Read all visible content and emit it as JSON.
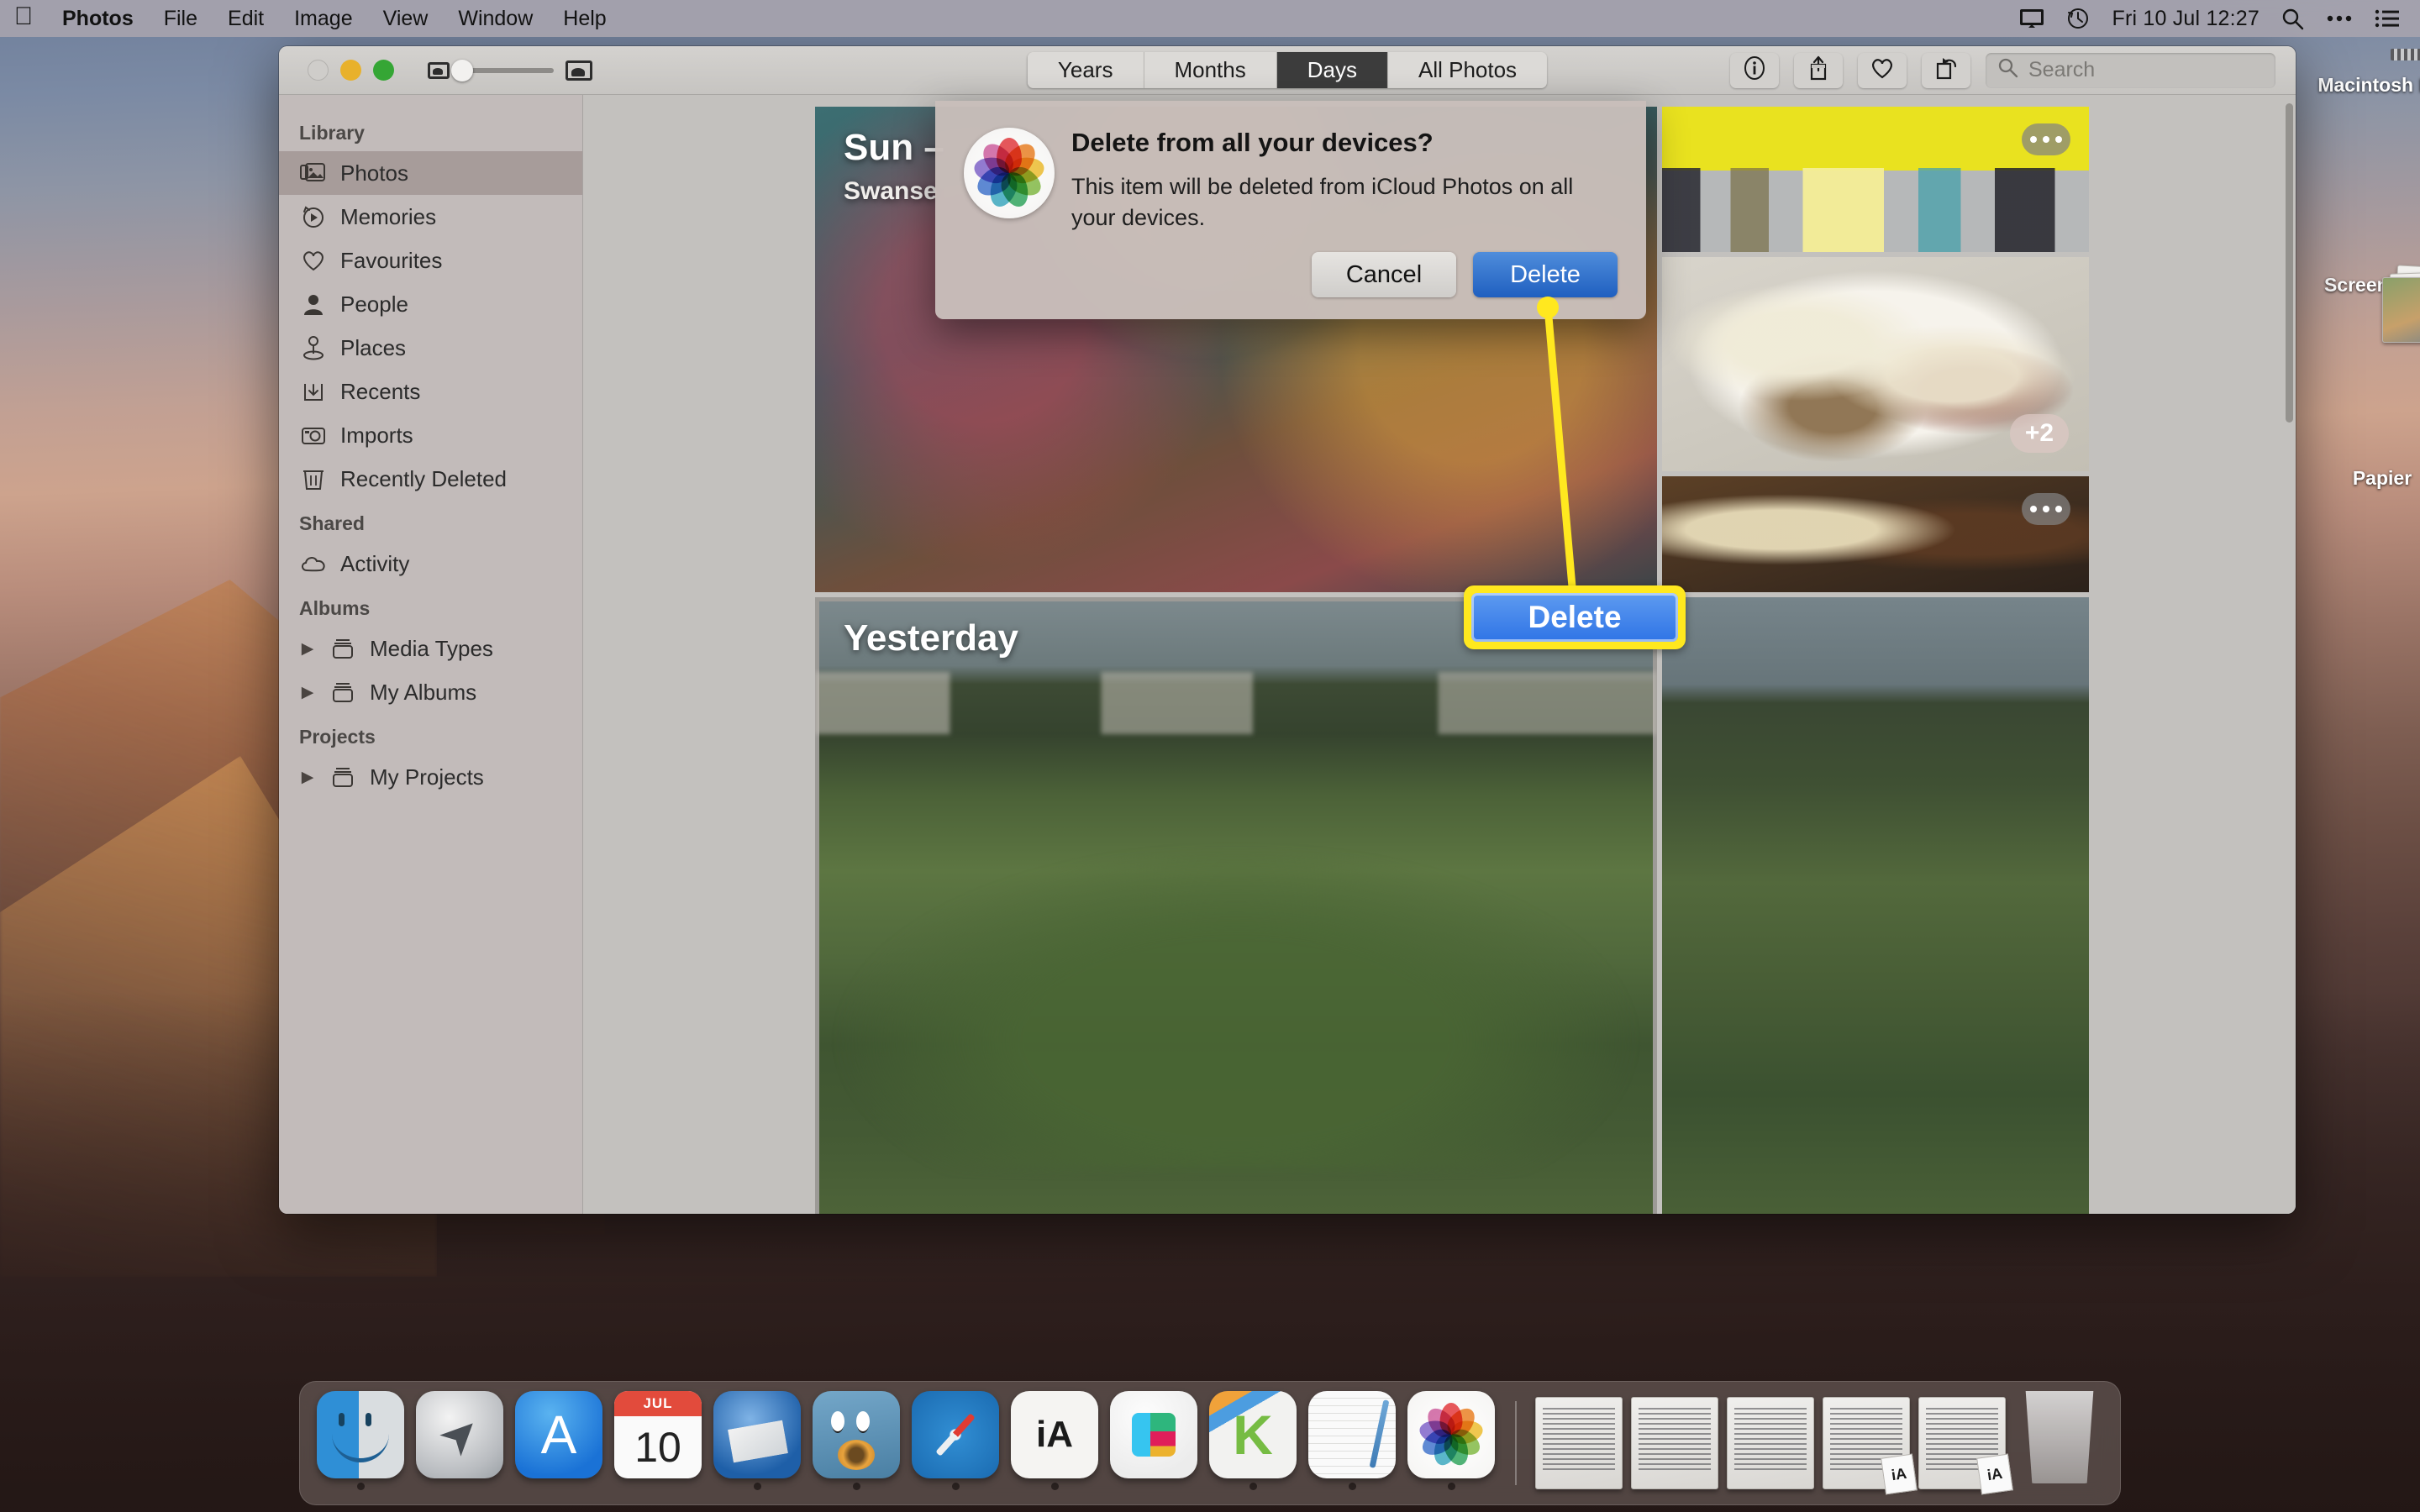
{
  "menubar": {
    "apple_logo": "apple-logo",
    "items": [
      "Photos",
      "File",
      "Edit",
      "Image",
      "View",
      "Window",
      "Help"
    ],
    "status": {
      "display_icon": "display-icon",
      "timemachine_icon": "time-machine-icon",
      "clock": "Fri 10 Jul  12:27",
      "search_icon": "search-icon",
      "control_center_icon": "control-center-icon",
      "siri_list_icon": "list-icon"
    }
  },
  "desktop": {
    "icons": [
      {
        "label": "Macintosh HD",
        "icon": "hard-drive-icon"
      },
      {
        "label": "Screenshots",
        "icon": "screenshots-folder-icon"
      },
      {
        "label": "Papier",
        "icon": "papier-folder-icon"
      }
    ]
  },
  "window": {
    "traffic_lights": [
      "close",
      "minimize",
      "maximize"
    ],
    "zoom_slider": {
      "small_icon": "small-thumbnail-icon",
      "large_icon": "large-thumbnail-icon",
      "value": 10
    },
    "segmented": {
      "options": [
        "Years",
        "Months",
        "Days",
        "All Photos"
      ],
      "selected": "Days"
    },
    "toolbar_buttons": [
      {
        "name": "info-button",
        "icon": "info-icon"
      },
      {
        "name": "share-button",
        "icon": "share-icon"
      },
      {
        "name": "favourite-button",
        "icon": "heart-icon"
      },
      {
        "name": "rotate-button",
        "icon": "rotate-icon"
      }
    ],
    "search": {
      "placeholder": "Search",
      "value": "",
      "icon": "search-icon"
    }
  },
  "sidebar": {
    "sections": [
      {
        "header": "Library",
        "items": [
          {
            "label": "Photos",
            "icon": "photos-stack-icon",
            "selected": true
          },
          {
            "label": "Memories",
            "icon": "memories-icon",
            "selected": false
          },
          {
            "label": "Favourites",
            "icon": "heart-icon",
            "selected": false
          },
          {
            "label": "People",
            "icon": "person-icon",
            "selected": false
          },
          {
            "label": "Places",
            "icon": "map-pin-icon",
            "selected": false
          },
          {
            "label": "Recents",
            "icon": "download-tray-icon",
            "selected": false
          },
          {
            "label": "Imports",
            "icon": "camera-icon",
            "selected": false
          },
          {
            "label": "Recently Deleted",
            "icon": "trash-icon",
            "selected": false
          }
        ]
      },
      {
        "header": "Shared",
        "items": [
          {
            "label": "Activity",
            "icon": "cloud-icon",
            "selected": false
          }
        ]
      },
      {
        "header": "Albums",
        "items": [
          {
            "label": "Media Types",
            "icon": "folder-icon",
            "disclosure": true,
            "selected": false
          },
          {
            "label": "My Albums",
            "icon": "folder-icon",
            "disclosure": true,
            "selected": false
          }
        ]
      },
      {
        "header": "Projects",
        "items": [
          {
            "label": "My Projects",
            "icon": "folder-icon",
            "disclosure": true,
            "selected": false
          }
        ]
      }
    ]
  },
  "grid": {
    "tiles": [
      {
        "name": "sunset-portrait-tile",
        "title": "Sun –",
        "subtitle": "Swanse",
        "badge": "",
        "overflow": false
      },
      {
        "name": "new-girl-tile",
        "title": "",
        "subtitle": "",
        "badge": "",
        "overflow": true
      },
      {
        "name": "tacos-tile",
        "title": "",
        "subtitle": "",
        "badge": "+2",
        "overflow": false
      },
      {
        "name": "pizza-tile",
        "title": "",
        "subtitle": "",
        "badge": "",
        "overflow": true
      },
      {
        "name": "yesterday-garden-tile",
        "title": "Yesterday",
        "subtitle": "",
        "badge": "",
        "overflow": false
      },
      {
        "name": "garden-thumb-tile",
        "title": "",
        "subtitle": "",
        "badge": "",
        "overflow": false
      }
    ]
  },
  "dialog": {
    "icon": "photos-app-icon",
    "title": "Delete from all your devices?",
    "message": "This item will be deleted from iCloud Photos on all your devices.",
    "cancel_label": "Cancel",
    "delete_label": "Delete"
  },
  "callout": {
    "label": "Delete",
    "highlight_color": "#ffe81f",
    "button_color": "#2f74e6"
  },
  "dock": {
    "apps": [
      {
        "label": "Finder",
        "icon": "finder-icon",
        "running": true
      },
      {
        "label": "Launchpad",
        "icon": "launchpad-icon",
        "running": false
      },
      {
        "label": "App Store",
        "icon": "app-store-icon",
        "running": false
      },
      {
        "label": "Calendar",
        "icon": "calendar-icon",
        "running": false,
        "cal_month": "JUL",
        "cal_day": "10"
      },
      {
        "label": "Thunderbird",
        "icon": "thunderbird-icon",
        "running": true
      },
      {
        "label": "Adium",
        "icon": "adium-icon",
        "running": true
      },
      {
        "label": "Safari",
        "icon": "safari-icon",
        "running": true
      },
      {
        "label": "iA Writer",
        "icon": "ia-writer-icon",
        "running": true
      },
      {
        "label": "Slack",
        "icon": "slack-icon",
        "running": false
      },
      {
        "label": "Kaleidoscope",
        "icon": "kaleidoscope-icon",
        "running": true
      },
      {
        "label": "Notes",
        "icon": "notes-icon",
        "running": true
      },
      {
        "label": "Photos",
        "icon": "photos-icon",
        "running": true
      }
    ],
    "documents": [
      {
        "label": "document-1",
        "badge": ""
      },
      {
        "label": "document-2",
        "badge": ""
      },
      {
        "label": "document-3",
        "badge": ""
      },
      {
        "label": "document-4",
        "badge": "iA"
      },
      {
        "label": "document-5",
        "badge": "iA"
      }
    ],
    "trash": {
      "label": "Trash",
      "icon": "trash-icon"
    }
  }
}
